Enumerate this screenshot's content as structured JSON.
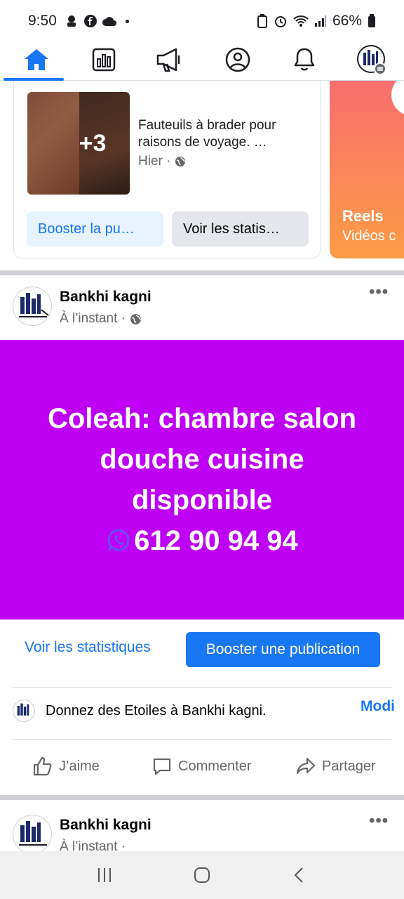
{
  "status": {
    "time": "9:50",
    "battery": "66%"
  },
  "nav": {
    "items": [
      "home-icon",
      "dashboard-icon",
      "megaphone-icon",
      "profile-icon",
      "bell-icon",
      "page-avatar-icon"
    ],
    "active": "home-icon"
  },
  "promo": {
    "more_count": "+3",
    "title": "Fauteuils à brader pour raisons de voyage. …",
    "meta": "Hier ·",
    "boost_label": "Booster la pu…",
    "stats_label": "Voir les statis…"
  },
  "reels": {
    "title": "Reels",
    "subtitle": "Vidéos c"
  },
  "post": {
    "author": "Bankhi kagni",
    "time": "À l’instant ·",
    "image_lines": [
      "Coleah: chambre salon",
      "douche cuisine",
      "disponible"
    ],
    "phone": "612 90 94 94",
    "stats_label": "Voir les statistiques",
    "boost_label": "Booster une publication",
    "rate_text": "Donnez des Etoiles à Bankhi kagni.",
    "rate_link": "Modi",
    "like_label": "J’aime",
    "comment_label": "Commenter",
    "share_label": "Partager"
  },
  "post2": {
    "author": "Bankhi kagni",
    "time": "À l’instant ·"
  },
  "colors": {
    "accent": "#1877f2",
    "post_bg": "#be00f4"
  }
}
